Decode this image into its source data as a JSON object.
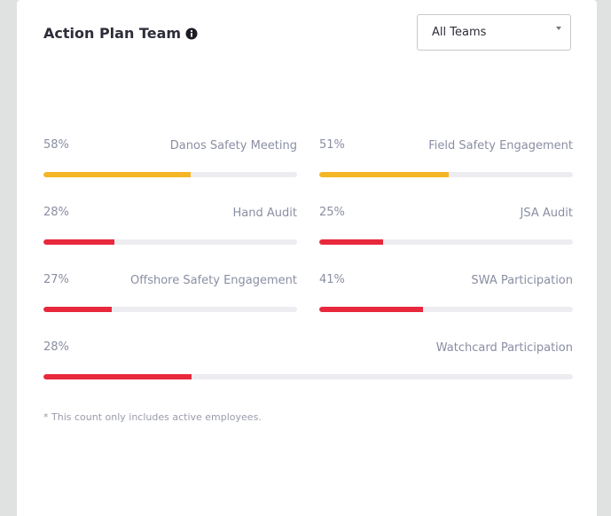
{
  "header": {
    "title": "Action Plan Team",
    "info_icon": "info-circle-icon"
  },
  "team_select": {
    "selected": "All Teams",
    "caret_icon": "caret-down-icon"
  },
  "colors": {
    "warning": "#f5b626",
    "danger": "#e8283d",
    "track": "#ededf1"
  },
  "metrics": [
    {
      "percent_label": "58%",
      "value": 0.58,
      "name": "Danos Safety Meeting",
      "status": "warning"
    },
    {
      "percent_label": "51%",
      "value": 0.51,
      "name": "Field Safety Engagement",
      "status": "warning"
    },
    {
      "percent_label": "28%",
      "value": 0.28,
      "name": "Hand Audit",
      "status": "danger"
    },
    {
      "percent_label": "25%",
      "value": 0.25,
      "name": "JSA Audit",
      "status": "danger"
    },
    {
      "percent_label": "27%",
      "value": 0.27,
      "name": "Offshore Safety Engagement",
      "status": "danger"
    },
    {
      "percent_label": "41%",
      "value": 0.41,
      "name": "SWA Participation",
      "status": "danger"
    },
    {
      "percent_label": "28%",
      "value": 0.28,
      "name": "Watchcard Participation",
      "status": "danger"
    }
  ],
  "footnote": "* This count only includes active employees."
}
